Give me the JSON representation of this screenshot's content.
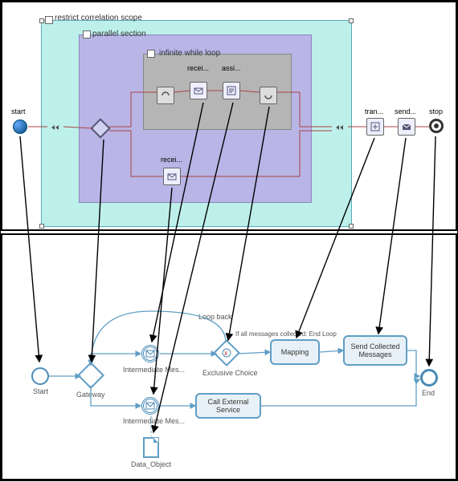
{
  "top": {
    "scopes": {
      "correlation": "restrict correlation scope",
      "parallel": "parallel section",
      "while": "infinite while loop"
    },
    "labels": {
      "start": "start",
      "stop": "stop",
      "receive1": "recei...",
      "assign": "assi...",
      "receive2": "recei...",
      "transform": "tran...",
      "send": "send..."
    }
  },
  "bottom": {
    "labels": {
      "start": "Start",
      "gateway": "Gateway",
      "intermediate_msg": "Intermediate Mes...",
      "exclusive_choice": "Exclusive Choice",
      "loop_back": "Loop back",
      "condition": "If all messages collected: End Loop",
      "mapping": "Mapping",
      "call_external": "Call External Service",
      "send_collected": "Send Collected Messages",
      "end": "End",
      "data_object": "Data_Object"
    }
  }
}
